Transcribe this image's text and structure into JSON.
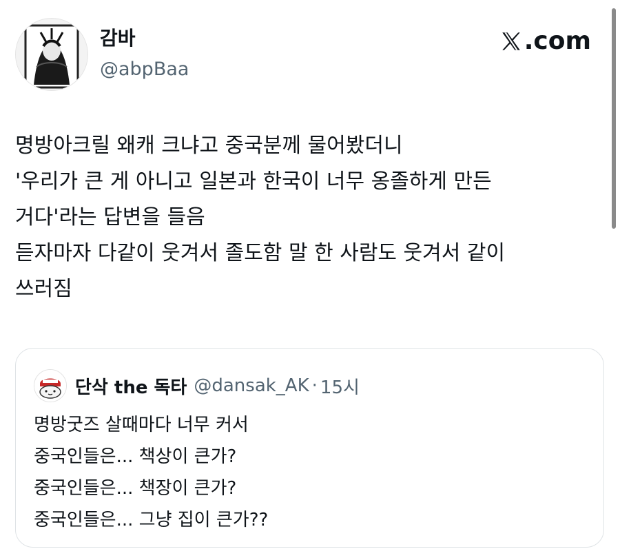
{
  "author": {
    "display_name": "감바",
    "handle": "@abpBaa",
    "avatar_icon": "profile-avatar-illustration"
  },
  "brand": {
    "text": "com",
    "icon": "x-logo-icon",
    "full": "X.com"
  },
  "tweet": {
    "lines": [
      "명방아크릴 왜캐 크냐고 중국분께 물어봤더니",
      "'우리가 큰 게 아니고 일본과 한국이 너무 옹졸하게 만든",
      "거다'라는 답변을 들음",
      "듣자마자 다같이 웃겨서 졸도함 말 한 사람도 웃겨서 같이",
      "쓰러짐"
    ]
  },
  "quoted": {
    "display_name": "단삭 the 독타",
    "handle": "@dansak_AK",
    "separator": "·",
    "time": "15시",
    "avatar_icon": "quoted-avatar-icon",
    "lines": [
      "명방굿즈 살때마다 너무 커서",
      "중국인들은... 책상이 큰가?",
      "중국인들은... 책장이 큰가?",
      "중국인들은... 그냥 집이 큰가??"
    ]
  },
  "colors": {
    "text_primary": "#0f1419",
    "text_secondary": "#536471",
    "border": "#dfe3e6",
    "background": "#ffffff"
  }
}
